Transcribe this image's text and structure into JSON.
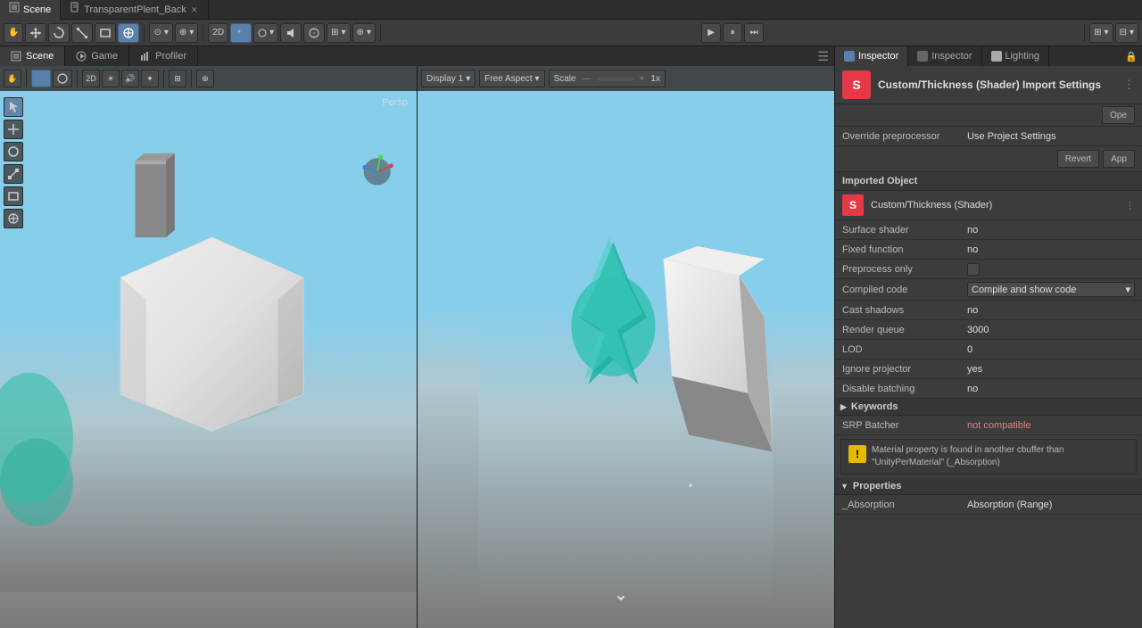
{
  "topTabs": [
    {
      "label": "Scene",
      "icon": "scene",
      "active": true,
      "closable": false
    },
    {
      "label": "TransparentPlent_Back",
      "icon": "file",
      "active": false,
      "closable": true
    }
  ],
  "toolbar": {
    "handTool": "✋",
    "moveTool": "↔",
    "rotateTool": "↻",
    "scaleTool": "⤡",
    "rectTool": "□",
    "transformTool": "⊕",
    "viewModeBtn": "2D",
    "shadingBtn": "●",
    "sceneViewButtons": [
      "●",
      "◉",
      "⚙",
      "🔊",
      "☁",
      "⊞",
      "⊕"
    ],
    "playBtn": "▶",
    "pauseBtn": "⏸",
    "stepBtn": "⏭"
  },
  "viewportTabs": [
    {
      "label": "Scene",
      "active": true
    },
    {
      "label": "Game",
      "active": false
    },
    {
      "label": "Profiler",
      "active": false
    }
  ],
  "scene": {
    "perspLabel": "Persp"
  },
  "game": {
    "displayDropdown": "Display 1",
    "aspectDropdown": "Free Aspect",
    "scaleLabel": "Scale",
    "scaleValue": "1x"
  },
  "inspector": {
    "tabs": [
      {
        "label": "Inspector",
        "active": true
      },
      {
        "label": "Inspector",
        "active": false
      },
      {
        "label": "Lighting",
        "active": false
      }
    ],
    "title": "Custom/Thickness (Shader) Import Settings",
    "openBtn": "Ope",
    "overridePreprocessorLabel": "Override preprocessor",
    "overridePreprocessorValue": "Use Project Settings",
    "revertBtn": "Revert",
    "applyBtn": "App",
    "importedObjectSection": "Imported Object",
    "importedObject": {
      "name": "Custom/Thickness (Shader)",
      "iconLetter": "S"
    },
    "properties": [
      {
        "label": "Surface shader",
        "value": "no",
        "type": "text"
      },
      {
        "label": "Fixed function",
        "value": "no",
        "type": "text"
      },
      {
        "label": "Preprocess only",
        "value": "",
        "type": "checkbox"
      },
      {
        "label": "Compiled code",
        "value": "Compile and show code",
        "type": "dropdown"
      },
      {
        "label": "Cast shadows",
        "value": "no",
        "type": "text"
      },
      {
        "label": "Render queue",
        "value": "3000",
        "type": "text"
      },
      {
        "label": "LOD",
        "value": "0",
        "type": "text"
      },
      {
        "label": "Ignore projector",
        "value": "yes",
        "type": "text"
      },
      {
        "label": "Disable batching",
        "value": "no",
        "type": "text"
      }
    ],
    "keywordsSection": "Keywords",
    "srpBatcherLabel": "SRP Batcher",
    "srpBatcherValue": "not compatible",
    "warning": "Material property is found in another cbuffer than \"UnityPerMaterial\" (_Absorption)",
    "propertiesSection": "Properties",
    "absorption": {
      "label": "_Absorption",
      "value": "Absorption (Range)"
    }
  }
}
